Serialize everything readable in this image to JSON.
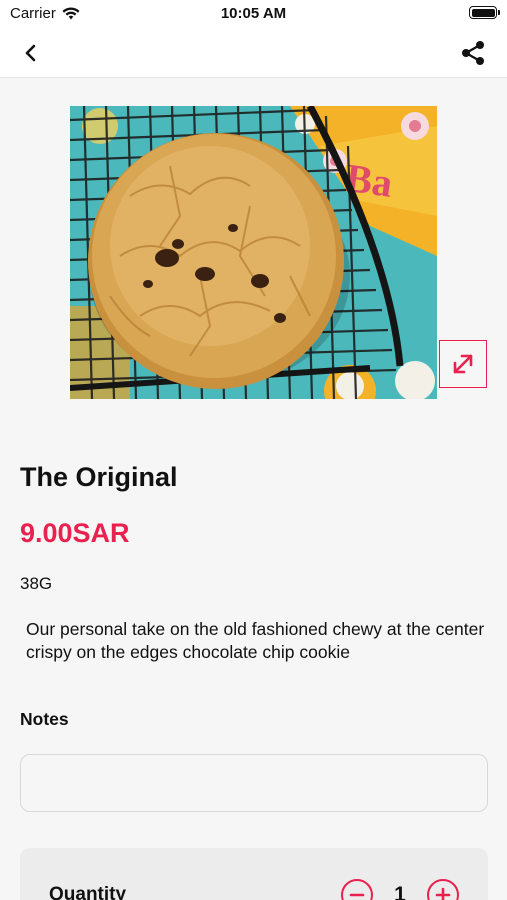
{
  "status_bar": {
    "carrier": "Carrier",
    "time": "10:05 AM",
    "icons": [
      "wifi-icon",
      "battery-icon"
    ]
  },
  "nav": {
    "icons": [
      "chevron-left-icon",
      "share-icon"
    ]
  },
  "product": {
    "image_icon": "cookie-photo",
    "expand_icon": "expand-icon",
    "title": "The Original",
    "price": "9.00SAR",
    "weight": "38G",
    "description": "Our personal take on the old fashioned chewy at the center crispy on the edges chocolate chip cookie"
  },
  "notes": {
    "label": "Notes",
    "value": "",
    "placeholder": ""
  },
  "quantity": {
    "label": "Quantity",
    "value": "1",
    "icons": [
      "minus-circle-icon",
      "plus-circle-icon"
    ]
  },
  "colors": {
    "accent": "#e8214e",
    "background": "#f6f6f6",
    "nav_background": "#ffffff",
    "text": "#111111"
  }
}
